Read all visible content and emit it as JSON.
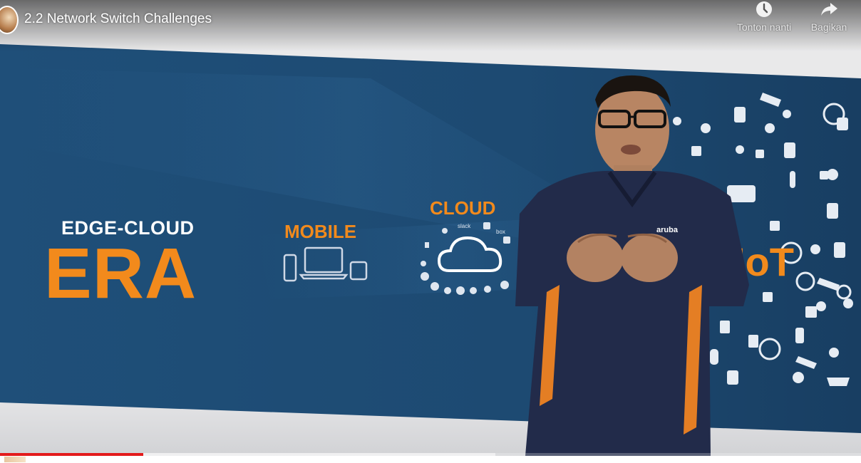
{
  "video": {
    "title": "2.2 Network Switch Challenges",
    "progress_played_fraction": 0.166,
    "progress_buffered_fraction": 0.575
  },
  "actions": {
    "watch_later_label": "Tonton nanti",
    "share_label": "Bagikan"
  },
  "slide": {
    "edge_cloud_label": "EDGE-CLOUD",
    "era_label": "ERA",
    "mobile_label": "MOBILE",
    "cloud_label": "CLOUD",
    "iot_label": "IoT",
    "cloud_service_labels": [
      "slack",
      "box"
    ],
    "shirt_logo": "aruba"
  },
  "colors": {
    "banner_blue": "#1d4a72",
    "accent_orange": "#f28a1c",
    "progress_red": "#e31b1b"
  }
}
